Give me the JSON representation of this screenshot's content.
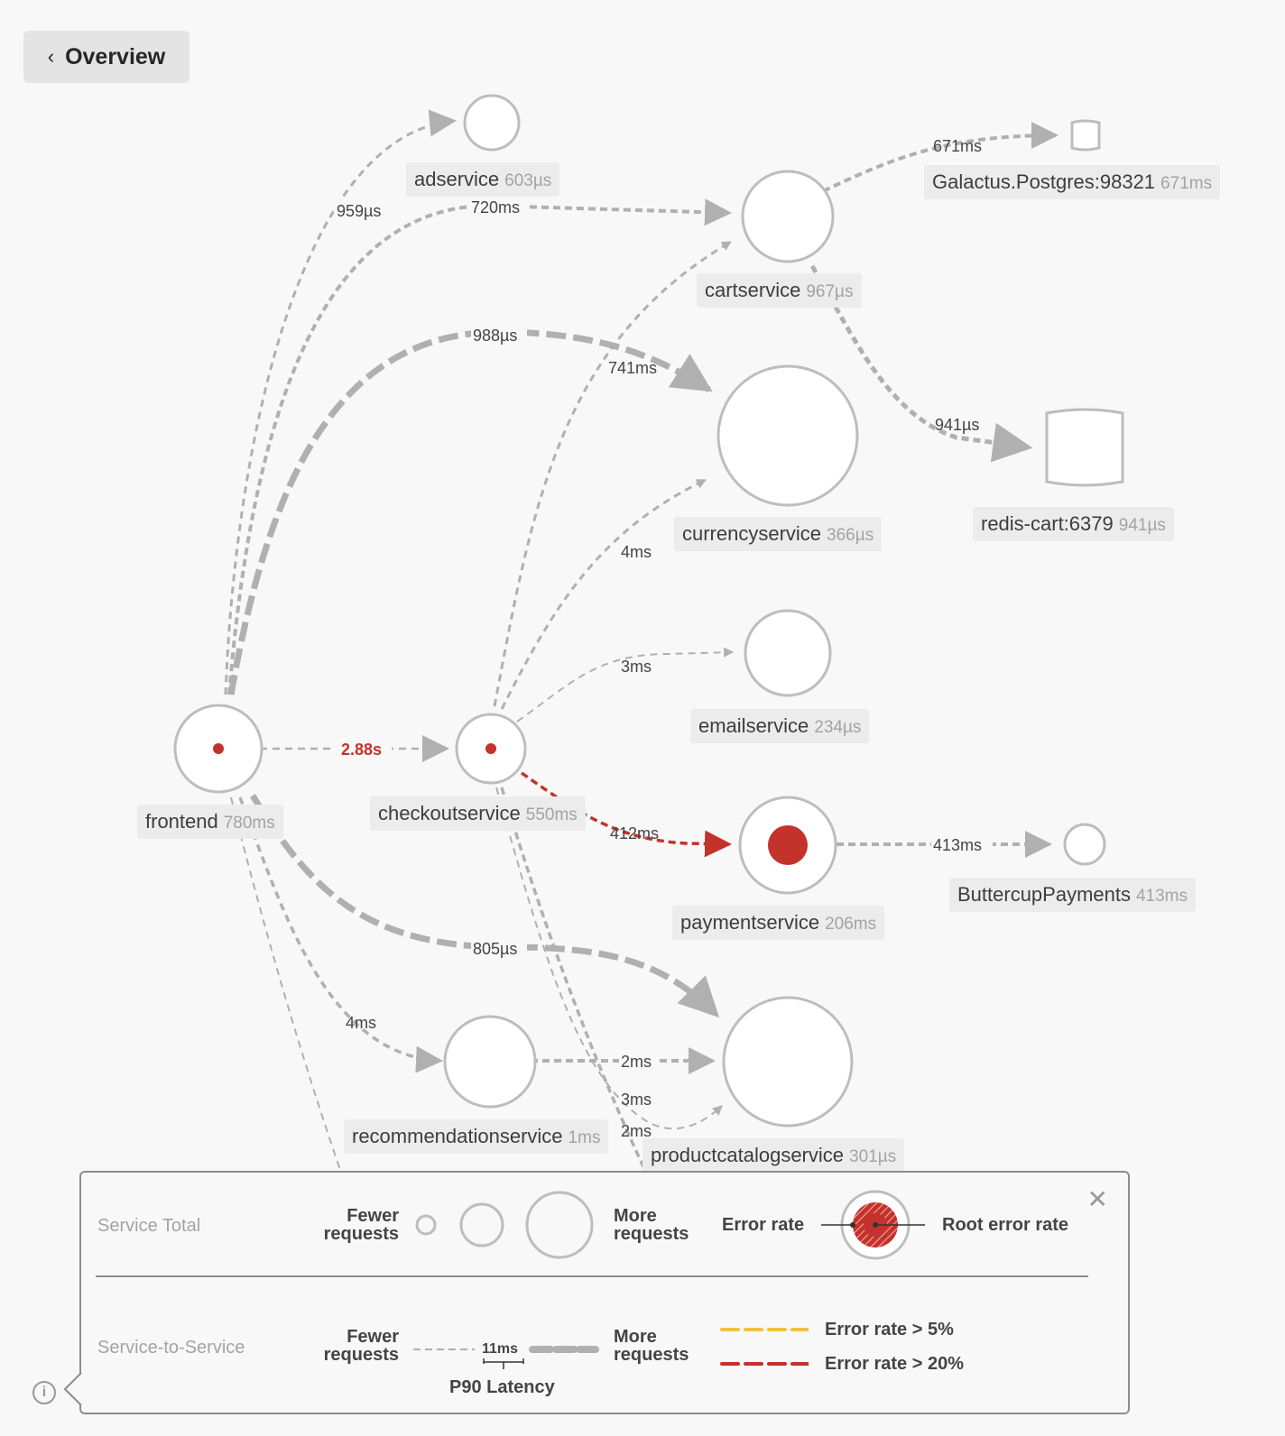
{
  "header": {
    "back_button_label": "Overview",
    "back_icon": "chevron-left-icon"
  },
  "colors": {
    "edge": "#b0b0b0",
    "node_stroke": "#bdbdbd",
    "error_red": "#c4322c",
    "warn_yellow": "#f2c040",
    "label_bg": "#ececec"
  },
  "nodes": [
    {
      "id": "adservice",
      "name": "adservice",
      "latency": "603µs",
      "shape": "circle",
      "error": "none"
    },
    {
      "id": "cartservice",
      "name": "cartservice",
      "latency": "967µs",
      "shape": "circle",
      "error": "none"
    },
    {
      "id": "galactus",
      "name": "Galactus.Postgres:98321",
      "latency": "671ms",
      "shape": "database",
      "error": "none"
    },
    {
      "id": "currencyservice",
      "name": "currencyservice",
      "latency": "366µs",
      "shape": "circle",
      "error": "none"
    },
    {
      "id": "redis",
      "name": "redis-cart:6379",
      "latency": "941µs",
      "shape": "database",
      "error": "none"
    },
    {
      "id": "emailservice",
      "name": "emailservice",
      "latency": "234µs",
      "shape": "circle",
      "error": "none"
    },
    {
      "id": "frontend",
      "name": "frontend",
      "latency": "780ms",
      "shape": "circle",
      "error": "small"
    },
    {
      "id": "checkoutservice",
      "name": "checkoutservice",
      "latency": "550ms",
      "shape": "circle",
      "error": "small"
    },
    {
      "id": "paymentservice",
      "name": "paymentservice",
      "latency": "206ms",
      "shape": "circle",
      "error": "root"
    },
    {
      "id": "buttercup",
      "name": "ButtercupPayments",
      "latency": "413ms",
      "shape": "circle",
      "error": "none"
    },
    {
      "id": "recommendationservice",
      "name": "recommendationservice",
      "latency": "1ms",
      "shape": "circle",
      "error": "none"
    },
    {
      "id": "productcatalogservice",
      "name": "productcatalogservice",
      "latency": "301µs",
      "shape": "circle",
      "error": "none"
    }
  ],
  "edges": [
    {
      "from": "frontend",
      "to": "adservice",
      "label": "959µs",
      "status": "ok"
    },
    {
      "from": "frontend",
      "to": "cartservice",
      "label": "720ms",
      "status": "ok"
    },
    {
      "from": "frontend",
      "to": "currencyservice",
      "label": "988µs",
      "status": "ok"
    },
    {
      "from": "checkoutservice",
      "to": "cartservice",
      "label": "741ms",
      "status": "ok"
    },
    {
      "from": "cartservice",
      "to": "galactus",
      "label": "671ms",
      "status": "ok"
    },
    {
      "from": "cartservice",
      "to": "redis",
      "label": "941µs",
      "status": "ok"
    },
    {
      "from": "checkoutservice",
      "to": "currencyservice",
      "label": "4ms",
      "status": "ok"
    },
    {
      "from": "checkoutservice",
      "to": "emailservice",
      "label": "3ms",
      "status": "ok"
    },
    {
      "from": "frontend",
      "to": "checkoutservice",
      "label": "2.88s",
      "status": "error"
    },
    {
      "from": "checkoutservice",
      "to": "paymentservice",
      "label": "412ms",
      "status": "error"
    },
    {
      "from": "paymentservice",
      "to": "buttercup",
      "label": "413ms",
      "status": "ok"
    },
    {
      "from": "frontend",
      "to": "productcatalogservice",
      "label": "805µs",
      "status": "ok"
    },
    {
      "from": "frontend",
      "to": "recommendationservice",
      "label": "4ms",
      "status": "ok"
    },
    {
      "from": "recommendationservice",
      "to": "productcatalogservice",
      "label": "2ms",
      "status": "ok"
    },
    {
      "from": "checkoutservice",
      "to": "productcatalogservice",
      "label": "3ms",
      "status": "ok"
    },
    {
      "from": "frontend",
      "to": "offscreen",
      "label": "2ms",
      "status": "ok"
    }
  ],
  "legend": {
    "service_total_title": "Service Total",
    "fewer_requests": "Fewer requests",
    "more_requests": "More requests",
    "error_rate": "Error rate",
    "root_error_rate": "Root error rate",
    "service_to_service_title": "Service-to-Service",
    "latency_sample": "11ms",
    "p90_latency": "P90 Latency",
    "error_gt_5": "Error rate > 5%",
    "error_gt_20": "Error rate > 20%",
    "close_icon": "close-icon",
    "info_icon": "info-icon"
  }
}
